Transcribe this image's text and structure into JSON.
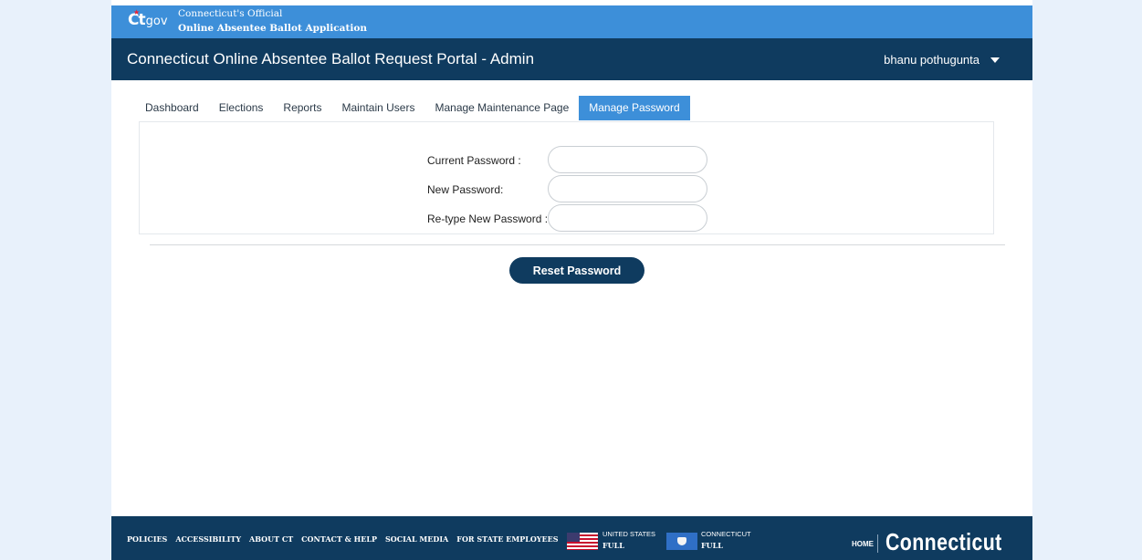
{
  "banner": {
    "logo_ct": "Ct",
    "logo_gov": "gov",
    "official_line1": "Connecticut's Official",
    "official_line2": "Online Absentee Ballot Application"
  },
  "header": {
    "title": "Connecticut Online Absentee Ballot Request Portal - Admin",
    "user": "bhanu pothugunta"
  },
  "tabs": [
    {
      "label": "Dashboard",
      "active": false
    },
    {
      "label": "Elections",
      "active": false
    },
    {
      "label": "Reports",
      "active": false
    },
    {
      "label": "Maintain Users",
      "active": false
    },
    {
      "label": "Manage Maintenance Page",
      "active": false
    },
    {
      "label": "Manage Password",
      "active": true
    }
  ],
  "form": {
    "current_password_label": "Current Password :",
    "current_password_value": "",
    "new_password_label": "New Password:",
    "new_password_value": "",
    "retype_password_label": "Re-type New Password :",
    "retype_password_value": "",
    "submit_label": "Reset Password"
  },
  "footer": {
    "links": [
      "POLICIES",
      "ACCESSIBILITY",
      "ABOUT CT",
      "CONTACT & HELP",
      "SOCIAL MEDIA",
      "FOR STATE EMPLOYEES"
    ],
    "us_flag_label": "UNITED STATES",
    "us_flag_status": "FULL",
    "ct_flag_label": "CONNECTICUT",
    "ct_flag_status": "FULL",
    "home_label": "HOME",
    "brand": "Connecticut"
  },
  "colors": {
    "banner_blue": "#3d8fd9",
    "navy": "#0f3b5f",
    "page_bg": "#e8f1fb"
  }
}
